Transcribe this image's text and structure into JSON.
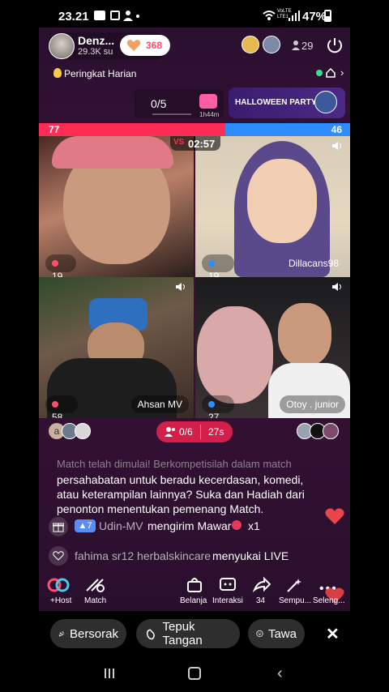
{
  "status": {
    "time": "23.21",
    "battery": "47%",
    "net_label": "VoLTE LTE1"
  },
  "host": {
    "name": "Denz...",
    "followers": "29.3K su",
    "like_count": "368"
  },
  "viewers": {
    "count": "29"
  },
  "ranking": {
    "label": "Peringkat Harian"
  },
  "mission": {
    "progress": "0/5",
    "timer": "1h44m"
  },
  "event": {
    "label": "HALLOWEEN PARTY"
  },
  "battle": {
    "left_score": "77",
    "right_score": "46",
    "left_share": 0.6,
    "countdown": "02:57"
  },
  "tiles": [
    {
      "badge": "19",
      "name": ""
    },
    {
      "badge": "19",
      "name": "Dillacans98"
    },
    {
      "badge": "58",
      "name": "Ahsan MV"
    },
    {
      "badge": "27",
      "name": "Otoy . junior"
    }
  ],
  "match_bar": {
    "left_initial": "a",
    "guests": "0/6",
    "time": "27s"
  },
  "chat": {
    "system_msg_partial": "Match telah dimulai! Berkompetisilah dalam match",
    "system_msg_lines": [
      "persahabatan untuk beradu kecerdasan, komedi,",
      "atau keterampilan lainnya? Suka dan Hadiah dari",
      "penonton menentukan pemenang Match."
    ],
    "gift": {
      "level": "7",
      "user": "Udin-MV",
      "action": "mengirim Mawar",
      "count": "x1"
    },
    "like": {
      "user": "fahima sr12 herbalskincare",
      "action": "menyukai LIVE"
    }
  },
  "toolbar": {
    "host_label": "+Host",
    "match_label": "Match",
    "shop_label": "Belanja",
    "interact_label": "Interaksi",
    "share_label": "34",
    "effects_label": "Sempu...",
    "more_label": "Seleng..."
  },
  "reactions": {
    "cheer": "Bersorak",
    "clap": "Tepuk Tangan",
    "laugh": "Tawa"
  },
  "colors": {
    "pink": "#ff2d55",
    "blue": "#2f8cff",
    "accent": "#ff4d6d"
  }
}
